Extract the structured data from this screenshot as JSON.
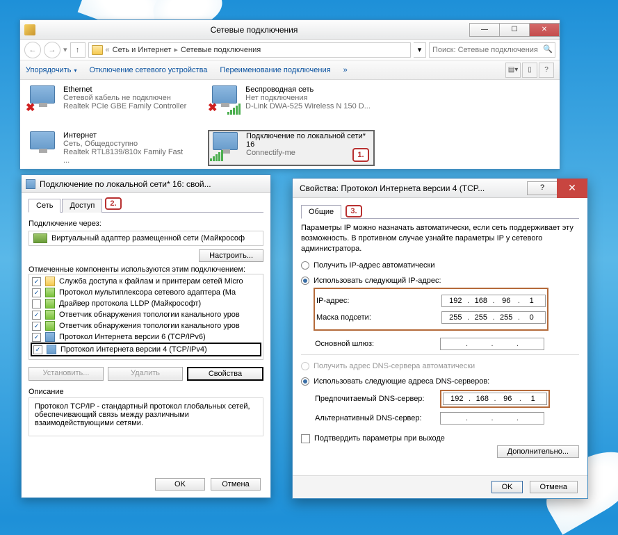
{
  "win1": {
    "title": "Сетевые подключения",
    "breadcrumbs": [
      "Сеть и Интернет",
      "Сетевые подключения"
    ],
    "search_placeholder": "Поиск: Сетевые подключения",
    "toolbar": {
      "organize": "Упорядочить",
      "disable": "Отключение сетевого устройства",
      "rename": "Переименование подключения"
    },
    "connections": [
      {
        "name": "Ethernet",
        "status": "Сетевой кабель не подключен",
        "device": "Realtek PCIe GBE Family Controller",
        "icon": "x"
      },
      {
        "name": "Беспроводная сеть",
        "status": "Нет подключения",
        "device": "D-Link DWA-525 Wireless N 150 D...",
        "icon": "bars-x"
      },
      {
        "name": "Интернет",
        "status": "Сеть, Общедоступно",
        "device": "Realtek RTL8139/810x Family Fast ...",
        "icon": "mon"
      },
      {
        "name": "Подключение по локальной сети* 16",
        "status": "",
        "device": "Connectify-me",
        "icon": "bars"
      }
    ],
    "callout": "1."
  },
  "win2": {
    "title": "Подключение по локальной сети* 16: свой...",
    "tabs": [
      "Сеть",
      "Доступ"
    ],
    "callout": "2.",
    "connect_via": "Подключение через:",
    "adapter": "Виртуальный адаптер размещенной сети (Майкрософ",
    "configure": "Настроить...",
    "components_label": "Отмеченные компоненты используются этим подключением:",
    "components": [
      {
        "checked": true,
        "icon": "yellow",
        "label": "Служба доступа к файлам и принтерам сетей Micro"
      },
      {
        "checked": true,
        "icon": "green",
        "label": "Протокол мультиплексора сетевого адаптера (Ма"
      },
      {
        "checked": false,
        "icon": "green",
        "label": "Драйвер протокола LLDP (Майкрософт)"
      },
      {
        "checked": true,
        "icon": "green",
        "label": "Ответчик обнаружения топологии канального уров"
      },
      {
        "checked": true,
        "icon": "green",
        "label": "Ответчик обнаружения топологии канального уров"
      },
      {
        "checked": true,
        "icon": "net",
        "label": "Протокол Интернета версии 6 (TCP/IPv6)"
      },
      {
        "checked": true,
        "icon": "net",
        "label": "Протокол Интернета версии 4 (TCP/IPv4)",
        "selected": true
      }
    ],
    "install": "Установить...",
    "uninstall": "Удалить",
    "properties": "Свойства",
    "desc_title": "Описание",
    "desc_text": "Протокол TCP/IP - стандартный протокол глобальных сетей, обеспечивающий связь между различными взаимодействующими сетями.",
    "ok": "OK",
    "cancel": "Отмена"
  },
  "win3": {
    "title": "Свойства: Протокол Интернета версии 4 (TCP...",
    "tab": "Общие",
    "callout": "3.",
    "intro": "Параметры IP можно назначать автоматически, если сеть поддерживает эту возможность. В противном случае узнайте параметры IP у сетевого администратора.",
    "radio_ip_auto": "Получить IP-адрес автоматически",
    "radio_ip_manual": "Использовать следующий IP-адрес:",
    "ip_label": "IP-адрес:",
    "ip_value": [
      "192",
      "168",
      "96",
      "1"
    ],
    "mask_label": "Маска подсети:",
    "mask_value": [
      "255",
      "255",
      "255",
      "0"
    ],
    "gateway_label": "Основной шлюз:",
    "gateway_value": [
      "",
      "",
      "",
      ""
    ],
    "radio_dns_auto": "Получить адрес DNS-сервера автоматически",
    "radio_dns_manual": "Использовать следующие адреса DNS-серверов:",
    "dns1_label": "Предпочитаемый DNS-сервер:",
    "dns1_value": [
      "192",
      "168",
      "96",
      "1"
    ],
    "dns2_label": "Альтернативный DNS-сервер:",
    "dns2_value": [
      "",
      "",
      "",
      ""
    ],
    "validate": "Подтвердить параметры при выходе",
    "advanced": "Дополнительно...",
    "ok": "OK",
    "cancel": "Отмена"
  }
}
